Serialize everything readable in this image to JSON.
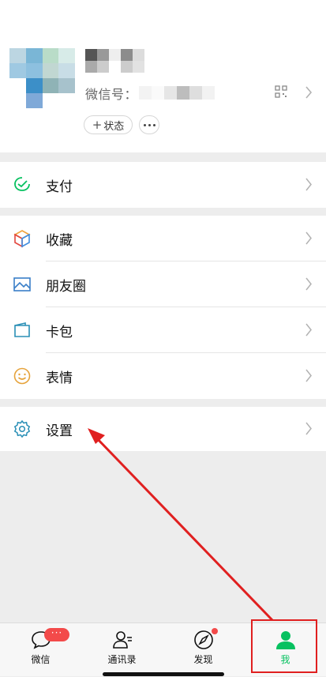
{
  "profile": {
    "wechat_id_label": "微信号：",
    "status_button": "状态",
    "status_plus": "+"
  },
  "menu": {
    "pay": "支付",
    "favorites": "收藏",
    "moments": "朋友圈",
    "cards": "卡包",
    "stickers": "表情",
    "settings": "设置"
  },
  "tabbar": {
    "chats": "微信",
    "contacts": "通讯录",
    "discover": "发现",
    "me": "我",
    "chats_badge": "···"
  },
  "colors": {
    "accent_green": "#07c160",
    "badge_red": "#f34a4a",
    "annotation_red": "#e02020"
  },
  "icons": {
    "pay": "pay-icon",
    "favorites": "cube-icon",
    "moments": "image-icon",
    "cards": "wallet-icon",
    "stickers": "smiley-icon",
    "settings": "gear-icon",
    "chats": "chat-bubble-icon",
    "contacts": "contacts-icon",
    "discover": "compass-icon",
    "me": "person-icon"
  }
}
